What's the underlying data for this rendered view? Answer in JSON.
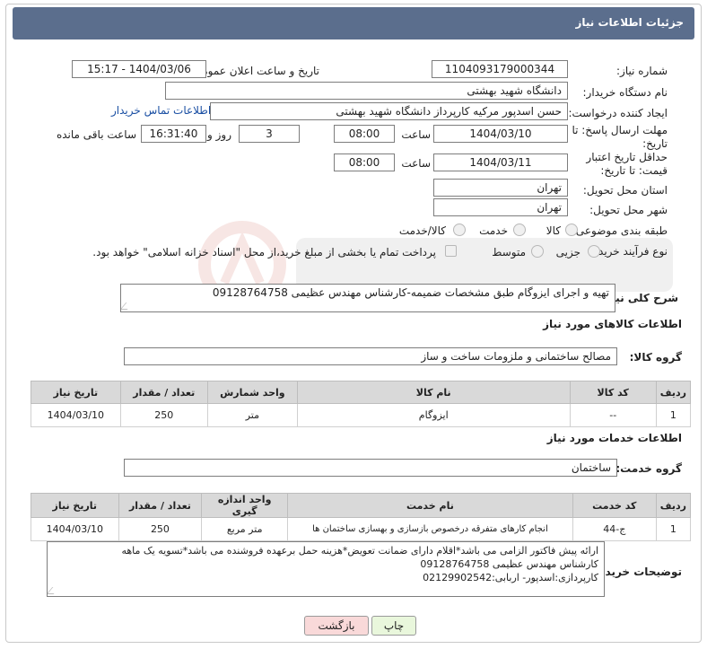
{
  "header": {
    "title": "جزئیات اطلاعات نیاز"
  },
  "fields": {
    "need_number_label": "شماره نیاز:",
    "need_number": "1104093179000344",
    "announce_label": "تاریخ و ساعت اعلان عمومی:",
    "announce_value": "1404/03/06 - 15:17",
    "buyer_org_label": "نام دستگاه خریدار:",
    "buyer_org": "دانشگاه شهید بهشتی",
    "creator_label": "ایجاد کننده درخواست:",
    "creator": "حسن اسدپور مرکیه کارپرداز دانشگاه شهید بهشتی",
    "contact_link": "اطلاعات تماس خریدار",
    "deadline_label": "مهلت ارسال پاسخ: تا تاریخ:",
    "deadline_date": "1404/03/10",
    "time_label": "ساعت",
    "deadline_time": "08:00",
    "days_value": "3",
    "days_label": "روز و",
    "remaining_time": "16:31:40",
    "remaining_label": "ساعت باقی مانده",
    "validity_label": "حداقل تاریخ اعتبار قیمت: تا تاریخ:",
    "validity_date": "1404/03/11",
    "validity_time": "08:00",
    "province_label": "استان محل تحویل:",
    "province": "تهران",
    "city_label": "شهر محل تحویل:",
    "city": "تهران",
    "category_label": "طبقه بندی موضوعی:",
    "category_options": [
      "کالا",
      "خدمت",
      "کالا/خدمت"
    ],
    "process_label": "نوع فرآیند خرید :",
    "process_options": [
      "جزیی",
      "متوسط"
    ],
    "payment_note": "پرداخت تمام یا بخشی از مبلغ خرید،از محل \"اسناد خزانه اسلامی\" خواهد بود."
  },
  "description": {
    "label": "شرح کلی نیاز:",
    "value": "تهیه و اجرای ایزوگام طبق مشخصات ضمیمه-کارشناس مهندس عظیمی 09128764758"
  },
  "goods": {
    "section_title": "اطلاعات کالاهای مورد نیاز",
    "group_label": "گروه کالا:",
    "group_value": "مصالح ساختمانی و ملزومات ساخت و ساز",
    "columns": [
      "ردیف",
      "کد کالا",
      "نام کالا",
      "واحد شمارش",
      "تعداد / مقدار",
      "تاریخ نیاز"
    ],
    "rows": [
      [
        "1",
        "--",
        "ایزوگام",
        "متر",
        "250",
        "1404/03/10"
      ]
    ]
  },
  "services": {
    "section_title": "اطلاعات خدمات مورد نیاز",
    "group_label": "گروه خدمت:",
    "group_value": "ساختمان",
    "columns": [
      "ردیف",
      "کد خدمت",
      "نام خدمت",
      "واحد اندازه گیری",
      "تعداد / مقدار",
      "تاریخ نیاز"
    ],
    "rows": [
      [
        "1",
        "ج-44",
        "انجام کارهای متفرقه درخصوص بازسازی و بهسازی ساختمان ها",
        "متر مربع",
        "250",
        "1404/03/10"
      ]
    ]
  },
  "buyer_notes": {
    "label": "توضیحات خریدار:",
    "lines": [
      "ارائه پیش فاکتور الزامی می باشد*اقلام دارای ضمانت تعویض*هزینه حمل برعهده فروشنده می باشد*تسویه یک ماهه",
      "کارشناس مهندس عظیمی 09128764758",
      "کارپردازی:اسدپور- اربابی:02129902542"
    ]
  },
  "buttons": {
    "print": "چاپ",
    "back": "بازگشت"
  },
  "colors": {
    "header": "#5b6e8d",
    "back_button": "#f9d9d9",
    "print_button": "#e9f7dc"
  }
}
